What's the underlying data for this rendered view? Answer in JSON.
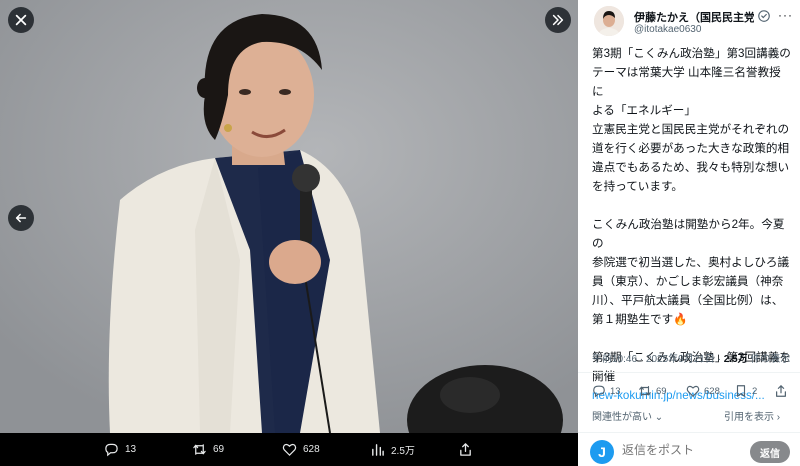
{
  "viewer": {
    "actions": {
      "reply_count": "13",
      "retweet_count": "69",
      "like_count": "628",
      "view_count": "2.5万"
    }
  },
  "tweet": {
    "author_name": "伊藤たかえ（国民民主党…",
    "author_handle": "@itotakae0630",
    "text_lines": [
      "第3期「こくみん政治塾」第3回講義の",
      "テーマは常葉大学 山本隆三名誉教授に",
      "よる「エネルギー」",
      "立憲民主党と国民民主党がそれぞれの",
      "道を行く必要があった大きな政策的相",
      "違点でもあるため、我々も特別な想い",
      "を持っています。",
      "",
      "こくみん政治塾は開塾から2年。今夏の",
      "参院選で初当選した、奥村よしひろ議",
      "員（東京）、かごしま彰宏議員（神奈",
      "川）、平戸航太議員（全国比例）は、",
      "第１期塾生です🔥",
      "",
      "第3期「こくみん政治塾」第3回講義を",
      "開催"
    ],
    "link": "new-kokumin.jp/news/business/...",
    "time": "午前10:46 · 2025年9月21日 · ",
    "views_value": "2.5万",
    "views_label": " 件の表示",
    "actions": {
      "reply_count": "13",
      "retweet_count": "69",
      "like_count": "628",
      "bookmark_count": "2"
    },
    "related_label": "関連性が高い",
    "likes_label": "引用を表示 ›"
  },
  "reply": {
    "avatar_letter": "J",
    "placeholder": "返信をポスト",
    "button_label": "返信"
  },
  "colors": {
    "accent": "#1d9bf0",
    "text_primary": "#0f1419",
    "text_secondary": "#536471"
  }
}
